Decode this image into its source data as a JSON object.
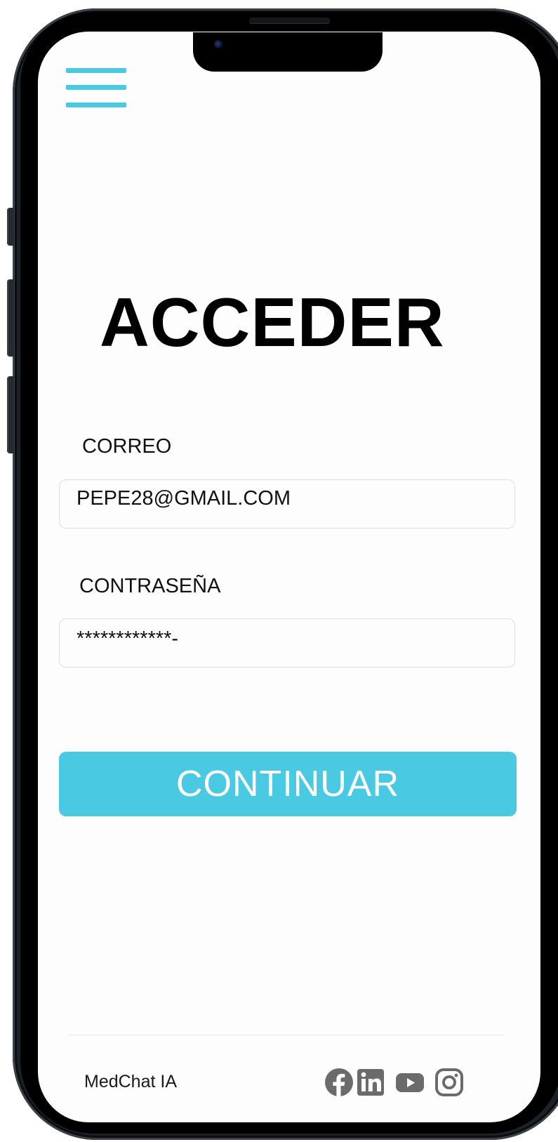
{
  "page": {
    "title": "ACCEDER"
  },
  "login_form": {
    "email_label": "CORREO",
    "email_value": "PEPE28@GMAIL.COM",
    "password_label": "CONTRASEÑA",
    "password_value": "************-",
    "continue_label": "CONTINUAR"
  },
  "footer": {
    "brand": "MedChat IA",
    "social_icons": [
      "facebook-icon",
      "linkedin-icon",
      "youtube-icon",
      "instagram-icon"
    ]
  },
  "colors": {
    "accent": "#4ac9e3",
    "icon_gray": "#6b6b6b",
    "text": "#000000"
  }
}
